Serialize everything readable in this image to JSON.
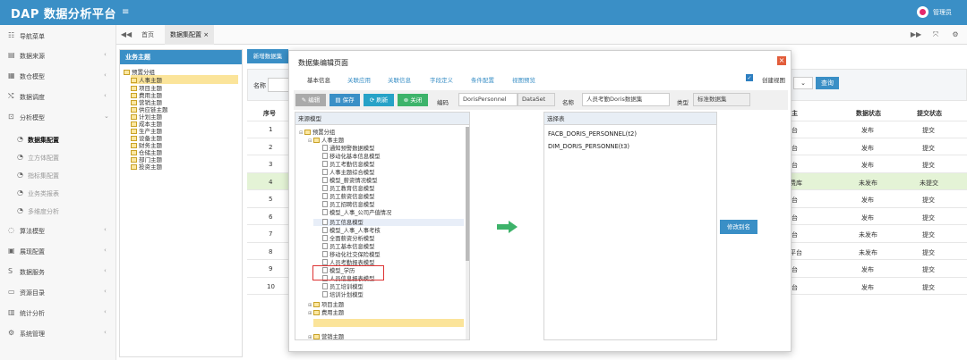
{
  "header": {
    "brand": "DAP 数据分析平台",
    "menu_icon": "≡",
    "username": "管理员"
  },
  "sidebar": {
    "items": [
      {
        "label": "导航菜单",
        "icon": "☷",
        "arrow": ""
      },
      {
        "label": "数据来源",
        "icon": "▤",
        "arrow": "‹"
      },
      {
        "label": "数仓模型",
        "icon": "▦",
        "arrow": "‹"
      },
      {
        "label": "数据调度",
        "icon": "⤭",
        "arrow": "‹"
      },
      {
        "label": "分析模型",
        "icon": "⊡",
        "arrow": "⌄"
      }
    ],
    "subitems": [
      {
        "label": "数据集配置",
        "icon": "◔"
      },
      {
        "label": "立方体配置",
        "icon": "◔"
      },
      {
        "label": "指标集配置",
        "icon": "◔"
      },
      {
        "label": "业务类报表",
        "icon": "◔"
      },
      {
        "label": "多维度分析",
        "icon": "◔"
      }
    ],
    "items2": [
      {
        "label": "算法模型",
        "icon": "◌",
        "arrow": "‹"
      },
      {
        "label": "展现配置",
        "icon": "▣",
        "arrow": "‹"
      },
      {
        "label": "数据服务",
        "icon": "S",
        "arrow": "‹"
      },
      {
        "label": "资源目录",
        "icon": "▭",
        "arrow": "‹"
      },
      {
        "label": "统计分析",
        "icon": "▥",
        "arrow": "‹"
      },
      {
        "label": "系统管理",
        "icon": "⚙",
        "arrow": "‹"
      }
    ]
  },
  "tabs": {
    "back": "◀◀",
    "home": "首页",
    "current": "数据集配置 ×",
    "fwd": "▶▶",
    "expand": "⤧",
    "gear": "⚙"
  },
  "tree": {
    "title": "业务主题",
    "root": "预置分组",
    "nodes": [
      "人事主题",
      "项目主题",
      "费用主题",
      "营销主题",
      "供应链主题",
      "计划主题",
      "成本主题",
      "生产主题",
      "设备主题",
      "财务主题",
      "仓储主题",
      "部门主题",
      "投资主题"
    ]
  },
  "main": {
    "new_button": "新增数据集",
    "filter_label": "名称",
    "select_tail": "⌄",
    "query_button": "查询"
  },
  "grid": {
    "headers": {
      "no": "序号",
      "right": "主",
      "status": "数据状态",
      "submit": "提交状态"
    },
    "rows": [
      {
        "no": "1",
        "right": "台",
        "status": "发布",
        "submit": "提交"
      },
      {
        "no": "2",
        "right": "台",
        "status": "发布",
        "submit": "提交"
      },
      {
        "no": "3",
        "right": "台",
        "status": "发布",
        "submit": "提交"
      },
      {
        "no": "4",
        "right": "费库",
        "status": "未发布",
        "submit": "未提交"
      },
      {
        "no": "5",
        "right": "台",
        "status": "发布",
        "submit": "提交"
      },
      {
        "no": "6",
        "right": "台",
        "status": "发布",
        "submit": "提交"
      },
      {
        "no": "7",
        "right": "台",
        "status": "未发布",
        "submit": "提交"
      },
      {
        "no": "8",
        "right": "平台",
        "status": "未发布",
        "submit": "提交"
      },
      {
        "no": "9",
        "right": "台",
        "status": "发布",
        "submit": "提交"
      },
      {
        "no": "10",
        "right": "台",
        "status": "发布",
        "submit": "提交"
      }
    ]
  },
  "modal": {
    "title": "数据集编辑页面",
    "close": "×",
    "tabs": [
      "基本信息",
      "关联应用",
      "关联信息",
      "字段定义",
      "条件配置",
      "视图预览"
    ],
    "create_view_label": "创建视图",
    "check": "✓",
    "toolbar": {
      "edit": "✎ 编辑",
      "save": "▤ 保存",
      "refresh": "⟳ 刷新",
      "close": "⊗ 关闭"
    },
    "code_label": "编码",
    "code_value": "DorisPersonnel",
    "dataset_value": "DataSet",
    "name_label": "名称",
    "name_value": "人员考勤Doris数据集",
    "type_label": "类型",
    "type_value": "标准数据集",
    "source_title": "来源模型",
    "source_tree": {
      "root": "预置分组",
      "group": "人事主题",
      "items": [
        "通知预警数据模型",
        "移动化基本信息模型",
        "员工考勤信息模型",
        "人事主题综合模型",
        "模型_薪资情况模型",
        "员工教育信息模型",
        "员工薪资信息模型",
        "员工招聘信息模型",
        "模型_人事_公司产值情况",
        "员工信息模型",
        "模型_人事_人事考核",
        "全面薪资分析模型",
        "员工基本信息模型",
        "移动化社交保险模型",
        "人员考勤报表模型",
        "模型_学历",
        "人员信息报表模型",
        "员工培训模型",
        "培训计划模型"
      ],
      "tail": [
        "项目主题",
        "费用主题",
        "营销主题"
      ]
    },
    "selected_title": "选择表",
    "selected_items": [
      "FACB_DORIS_PERSONNEL(t2)",
      "DIM_DORIS_PERSONNE(t3)"
    ],
    "alias_button": "修改别名"
  }
}
